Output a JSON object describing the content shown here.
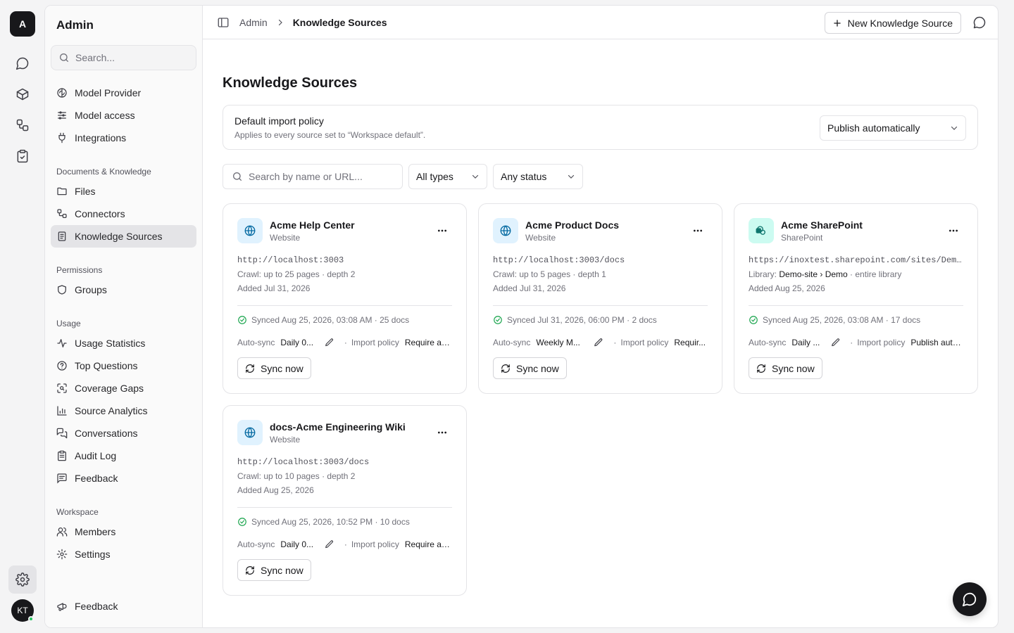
{
  "rail": {
    "logo_letter": "A",
    "avatar_initials": "KT",
    "icons": [
      "chat-icon",
      "box-icon",
      "workflow-icon",
      "clipboard-check-icon",
      "gear-icon"
    ]
  },
  "sidebar": {
    "title": "Admin",
    "search_placeholder": "Search...",
    "top_items": [
      {
        "label": "Model Provider",
        "icon": "brain-icon"
      },
      {
        "label": "Model access",
        "icon": "sliders-icon"
      },
      {
        "label": "Integrations",
        "icon": "plug-icon"
      }
    ],
    "groups": [
      {
        "label": "Documents & Knowledge",
        "items": [
          {
            "label": "Files",
            "icon": "folder-icon"
          },
          {
            "label": "Connectors",
            "icon": "workflow-icon"
          },
          {
            "label": "Knowledge Sources",
            "icon": "book-icon",
            "active": true
          }
        ]
      },
      {
        "label": "Permissions",
        "items": [
          {
            "label": "Groups",
            "icon": "shield-icon"
          }
        ]
      },
      {
        "label": "Usage",
        "items": [
          {
            "label": "Usage Statistics",
            "icon": "activity-icon"
          },
          {
            "label": "Top Questions",
            "icon": "help-circle-icon"
          },
          {
            "label": "Coverage Gaps",
            "icon": "scan-search-icon"
          },
          {
            "label": "Source Analytics",
            "icon": "bar-chart-icon"
          },
          {
            "label": "Conversations",
            "icon": "messages-icon"
          },
          {
            "label": "Audit Log",
            "icon": "clipboard-list-icon"
          },
          {
            "label": "Feedback",
            "icon": "message-square-text-icon"
          }
        ]
      },
      {
        "label": "Workspace",
        "items": [
          {
            "label": "Members",
            "icon": "users-icon"
          },
          {
            "label": "Settings",
            "icon": "gear-icon"
          }
        ]
      }
    ],
    "footer_item": {
      "label": "Feedback",
      "icon": "megaphone-icon"
    }
  },
  "topbar": {
    "breadcrumb": [
      "Admin",
      "Knowledge Sources"
    ],
    "new_button_label": "New Knowledge Source"
  },
  "main": {
    "title": "Knowledge Sources",
    "policy": {
      "title": "Default import policy",
      "subtitle": "Applies to every source set to “Workspace default”.",
      "selected": "Publish automatically"
    },
    "filters": {
      "search_placeholder": "Search by name or URL...",
      "type_selected": "All types",
      "status_selected": "Any status"
    },
    "cards": [
      {
        "name": "Acme Help Center",
        "type": "Website",
        "icon": "globe-icon",
        "url": "http://localhost:3003",
        "detail": "Crawl: up to 25 pages · depth 2",
        "added": "Added Jul 31, 2026",
        "synced": "Synced Aug 25, 2026, 03:08 AM · 25 docs",
        "autosync_label": "Auto-sync",
        "autosync_value": "Daily 0...",
        "policy_label": "Import policy",
        "policy_value": "Require ap...",
        "sync_label": "Sync now"
      },
      {
        "name": "Acme Product Docs",
        "type": "Website",
        "icon": "globe-icon",
        "url": "http://localhost:3003/docs",
        "detail": "Crawl: up to 5 pages · depth 1",
        "added": "Added Jul 31, 2026",
        "synced": "Synced Jul 31, 2026, 06:00 PM · 2 docs",
        "autosync_label": "Auto-sync",
        "autosync_value": "Weekly M...",
        "policy_label": "Import policy",
        "policy_value": "Requir...",
        "sync_label": "Sync now"
      },
      {
        "name": "Acme SharePoint",
        "type": "SharePoint",
        "icon": "sharepoint-icon",
        "url": "https://inoxtest.sharepoint.com/sites/Demo-site",
        "detail_prefix": "Library: ",
        "detail_strong": "Demo-site › Demo",
        "detail_suffix": " · entire library",
        "added": "Added Aug 25, 2026",
        "synced": "Synced Aug 25, 2026, 03:08 AM · 17 docs",
        "autosync_label": "Auto-sync",
        "autosync_value": "Daily ...",
        "policy_label": "Import policy",
        "policy_value": "Publish auto...",
        "sync_label": "Sync now"
      },
      {
        "name": "docs-Acme Engineering Wiki",
        "type": "Website",
        "icon": "globe-icon",
        "url": "http://localhost:3003/docs",
        "detail": "Crawl: up to 10 pages · depth 2",
        "added": "Added Aug 25, 2026",
        "synced": "Synced Aug 25, 2026, 10:52 PM · 10 docs",
        "autosync_label": "Auto-sync",
        "autosync_value": "Daily 0...",
        "policy_label": "Import policy",
        "policy_value": "Require ap...",
        "sync_label": "Sync now"
      }
    ]
  }
}
